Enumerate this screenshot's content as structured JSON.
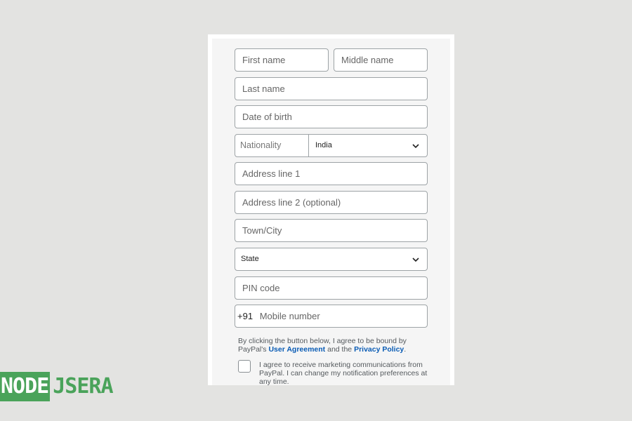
{
  "form": {
    "first_name_placeholder": "First name",
    "middle_name_placeholder": "Middle name",
    "last_name_placeholder": "Last name",
    "dob_placeholder": "Date of birth",
    "nationality_label": "Nationality",
    "nationality_value": "India",
    "address1_placeholder": "Address line 1",
    "address2_placeholder": "Address line 2 (optional)",
    "town_placeholder": "Town/City",
    "state_value": "State",
    "pin_placeholder": "PIN code",
    "phone_prefix": "+91",
    "mobile_placeholder": "Mobile number"
  },
  "legal": {
    "text_before": "By clicking the button below, I agree to be bound by PayPal's ",
    "user_agreement_link": "User Agreement",
    "text_middle": " and the ",
    "privacy_link": "Privacy Policy",
    "text_after": "."
  },
  "marketing": {
    "text": "I agree to receive marketing communications from PayPal. I can change my notification preferences at any time."
  },
  "logo": {
    "part1": "NODE",
    "part2": "JSERA"
  },
  "colors": {
    "background": "#e3e3e1",
    "link": "#0a5cb5",
    "logo_green": "#4aa35a",
    "footer_bar": "#1b2f63"
  }
}
